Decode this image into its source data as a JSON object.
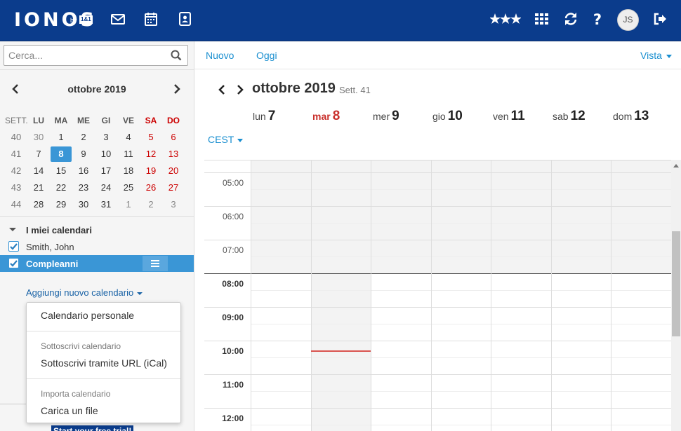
{
  "topbar": {
    "logo": "IONOS",
    "logo_by": "by",
    "logo_brand": "1&1",
    "icons": [
      "mail-icon",
      "calendar-icon",
      "contacts-icon",
      "stars-icon",
      "apps-grid-icon",
      "refresh-icon",
      "help-icon",
      "logout-icon"
    ],
    "avatar_initials": "JS",
    "color": "#0b3c8c"
  },
  "search": {
    "placeholder": "Cerca..."
  },
  "mini_calendar": {
    "title": "ottobre 2019",
    "headers": [
      "SETT.",
      "LU",
      "MA",
      "ME",
      "GI",
      "VE",
      "SA",
      "DO"
    ],
    "weeks": [
      [
        "40",
        "30",
        "1",
        "2",
        "3",
        "4",
        "5",
        "6"
      ],
      [
        "41",
        "7",
        "8",
        "9",
        "10",
        "11",
        "12",
        "13"
      ],
      [
        "42",
        "14",
        "15",
        "16",
        "17",
        "18",
        "19",
        "20"
      ],
      [
        "43",
        "21",
        "22",
        "23",
        "24",
        "25",
        "26",
        "27"
      ],
      [
        "44",
        "28",
        "29",
        "30",
        "31",
        "1",
        "2",
        "3"
      ]
    ],
    "today": "8"
  },
  "calendars": {
    "section_title": "I miei calendari",
    "items": [
      {
        "label": "Smith, John",
        "checked": true
      },
      {
        "label": "Compleanni",
        "checked": true,
        "selected": true
      }
    ],
    "add_link": "Aggiungi nuovo calendario"
  },
  "add_menu": {
    "personal": "Calendario personale",
    "subscribe_heading": "Sottoscrivi calendario",
    "subscribe_url": "Sottoscrivi tramite URL (iCal)",
    "import_heading": "Importa calendario",
    "upload": "Carica un file"
  },
  "promo": "Start your free trial!",
  "toolbar": {
    "new": "Nuovo",
    "today": "Oggi",
    "view": "Vista"
  },
  "week_view": {
    "title": "ottobre 2019",
    "week_label": "Sett. 41",
    "days": [
      {
        "name": "lun",
        "date": "7"
      },
      {
        "name": "mar",
        "date": "8",
        "today": true
      },
      {
        "name": "mer",
        "date": "9"
      },
      {
        "name": "gio",
        "date": "10"
      },
      {
        "name": "ven",
        "date": "11"
      },
      {
        "name": "sab",
        "date": "12"
      },
      {
        "name": "dom",
        "date": "13"
      }
    ],
    "timezone": "CEST",
    "hours": [
      "05:00",
      "06:00",
      "07:00",
      "08:00",
      "09:00",
      "10:00",
      "11:00",
      "12:00"
    ],
    "work_start": "08:00",
    "accent_color": "#1a8fd0",
    "today_color": "#c9302c",
    "selected_color": "#3a96d6"
  }
}
